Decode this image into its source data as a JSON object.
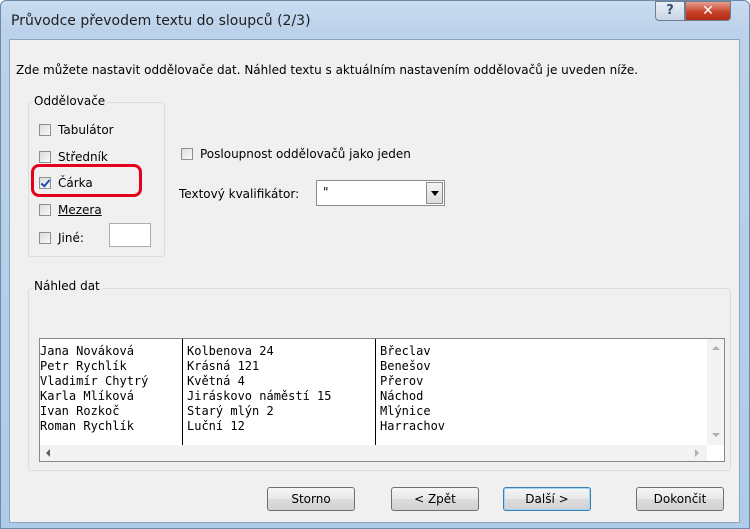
{
  "window": {
    "title": "Průvodce převodem textu do sloupců (2/3)",
    "help_symbol": "?",
    "close_symbol": "✕"
  },
  "description": "Zde můžete nastavit oddělovače dat. Náhled textu s aktuálním nastavením oddělovačů je uveden níže.",
  "delimiters": {
    "legend": "Oddělovače",
    "items": [
      {
        "label": "Tabulátor",
        "checked": false
      },
      {
        "label": "Středník",
        "checked": false
      },
      {
        "label": "Čárka",
        "checked": true
      },
      {
        "label": "Mezera",
        "checked": false
      },
      {
        "label": "Jiné:",
        "checked": false
      }
    ],
    "other_value": ""
  },
  "consecutive": {
    "label": "Posloupnost oddělovačů jako jeden",
    "checked": false
  },
  "qualifier": {
    "label": "Textový kvalifikátor:",
    "value": "\""
  },
  "preview": {
    "legend": "Náhled dat",
    "rows": [
      [
        "Jana Nováková",
        "Kolbenova 24",
        "Břeclav"
      ],
      [
        "Petr Rychlík",
        "Krásná 121",
        "Benešov"
      ],
      [
        "Vladimír Chytrý",
        "Květná 4",
        "Přerov"
      ],
      [
        "Karla Mlíková",
        "Jiráskovo náměstí 15",
        "Náchod"
      ],
      [
        "Ivan Rozkoč",
        "Starý mlýn 2",
        "Mlýnice"
      ],
      [
        "Roman Rychlík",
        "Luční 12",
        "Harrachov"
      ]
    ]
  },
  "buttons": {
    "cancel": "Storno",
    "back": "< Zpět",
    "next": "Další >",
    "finish": "Dokončit"
  },
  "colors": {
    "highlight": "#e5001b",
    "close": "#c7432a"
  }
}
